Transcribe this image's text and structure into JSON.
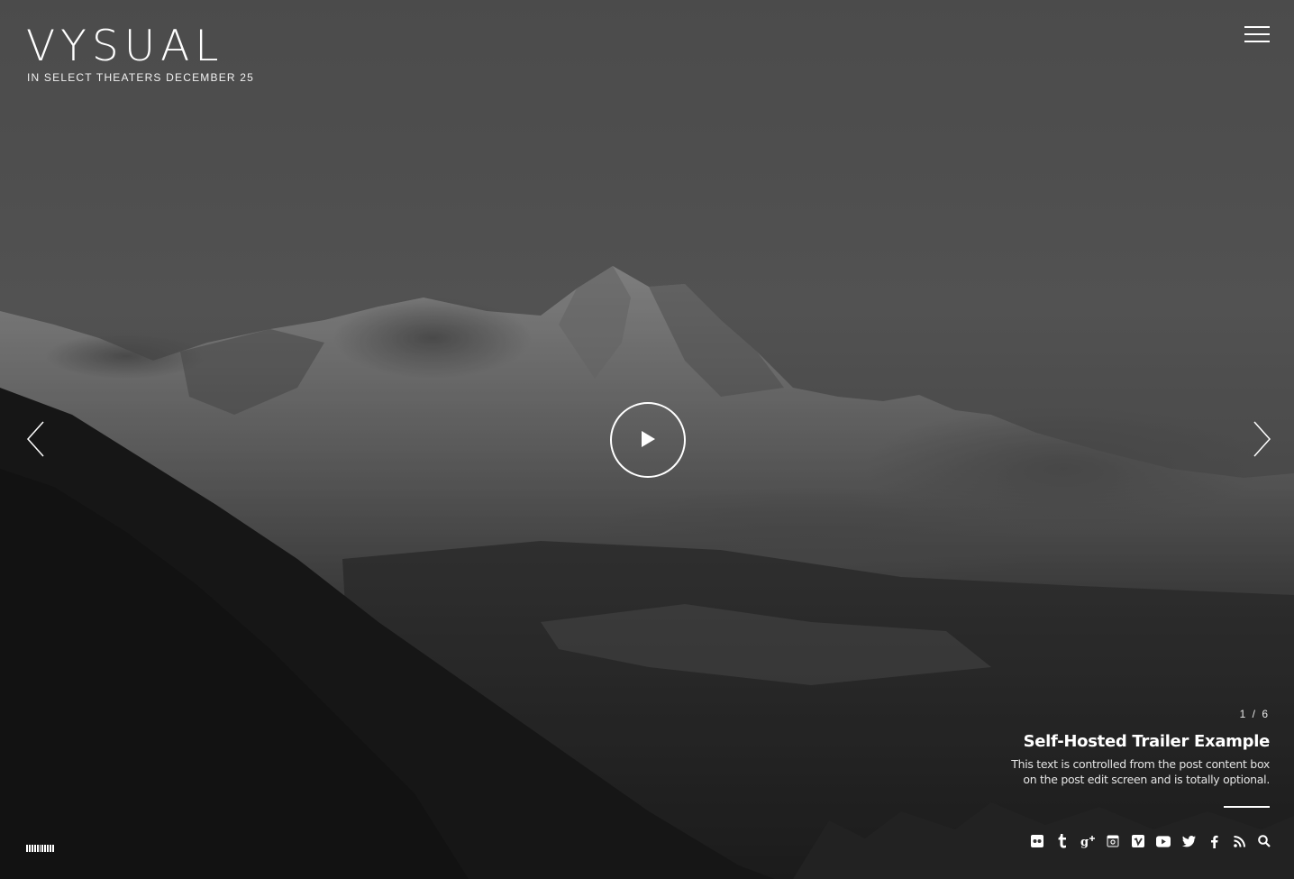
{
  "site": {
    "logo": "VYSUAL",
    "tagline": "IN SELECT THEATERS DECEMBER 25"
  },
  "header": {
    "menu_icon": "hamburger-menu-icon"
  },
  "slider": {
    "prev_icon": "chevron-left-icon",
    "next_icon": "chevron-right-icon",
    "play_icon": "play-icon",
    "counter": "1 / 6",
    "title": "Self-Hosted Trailer Example",
    "description": "This text is controlled from the post content box\non the post edit screen and is totally optional."
  },
  "social": [
    "flickr-icon",
    "tumblr-icon",
    "google-plus-icon",
    "instagram-icon",
    "vimeo-icon",
    "youtube-icon",
    "twitter-icon",
    "facebook-icon",
    "rss-icon",
    "search-icon"
  ],
  "colors": {
    "text": "#ffffff",
    "sky": "#5a5a5a",
    "mountain_dark": "#1a1a1a"
  }
}
